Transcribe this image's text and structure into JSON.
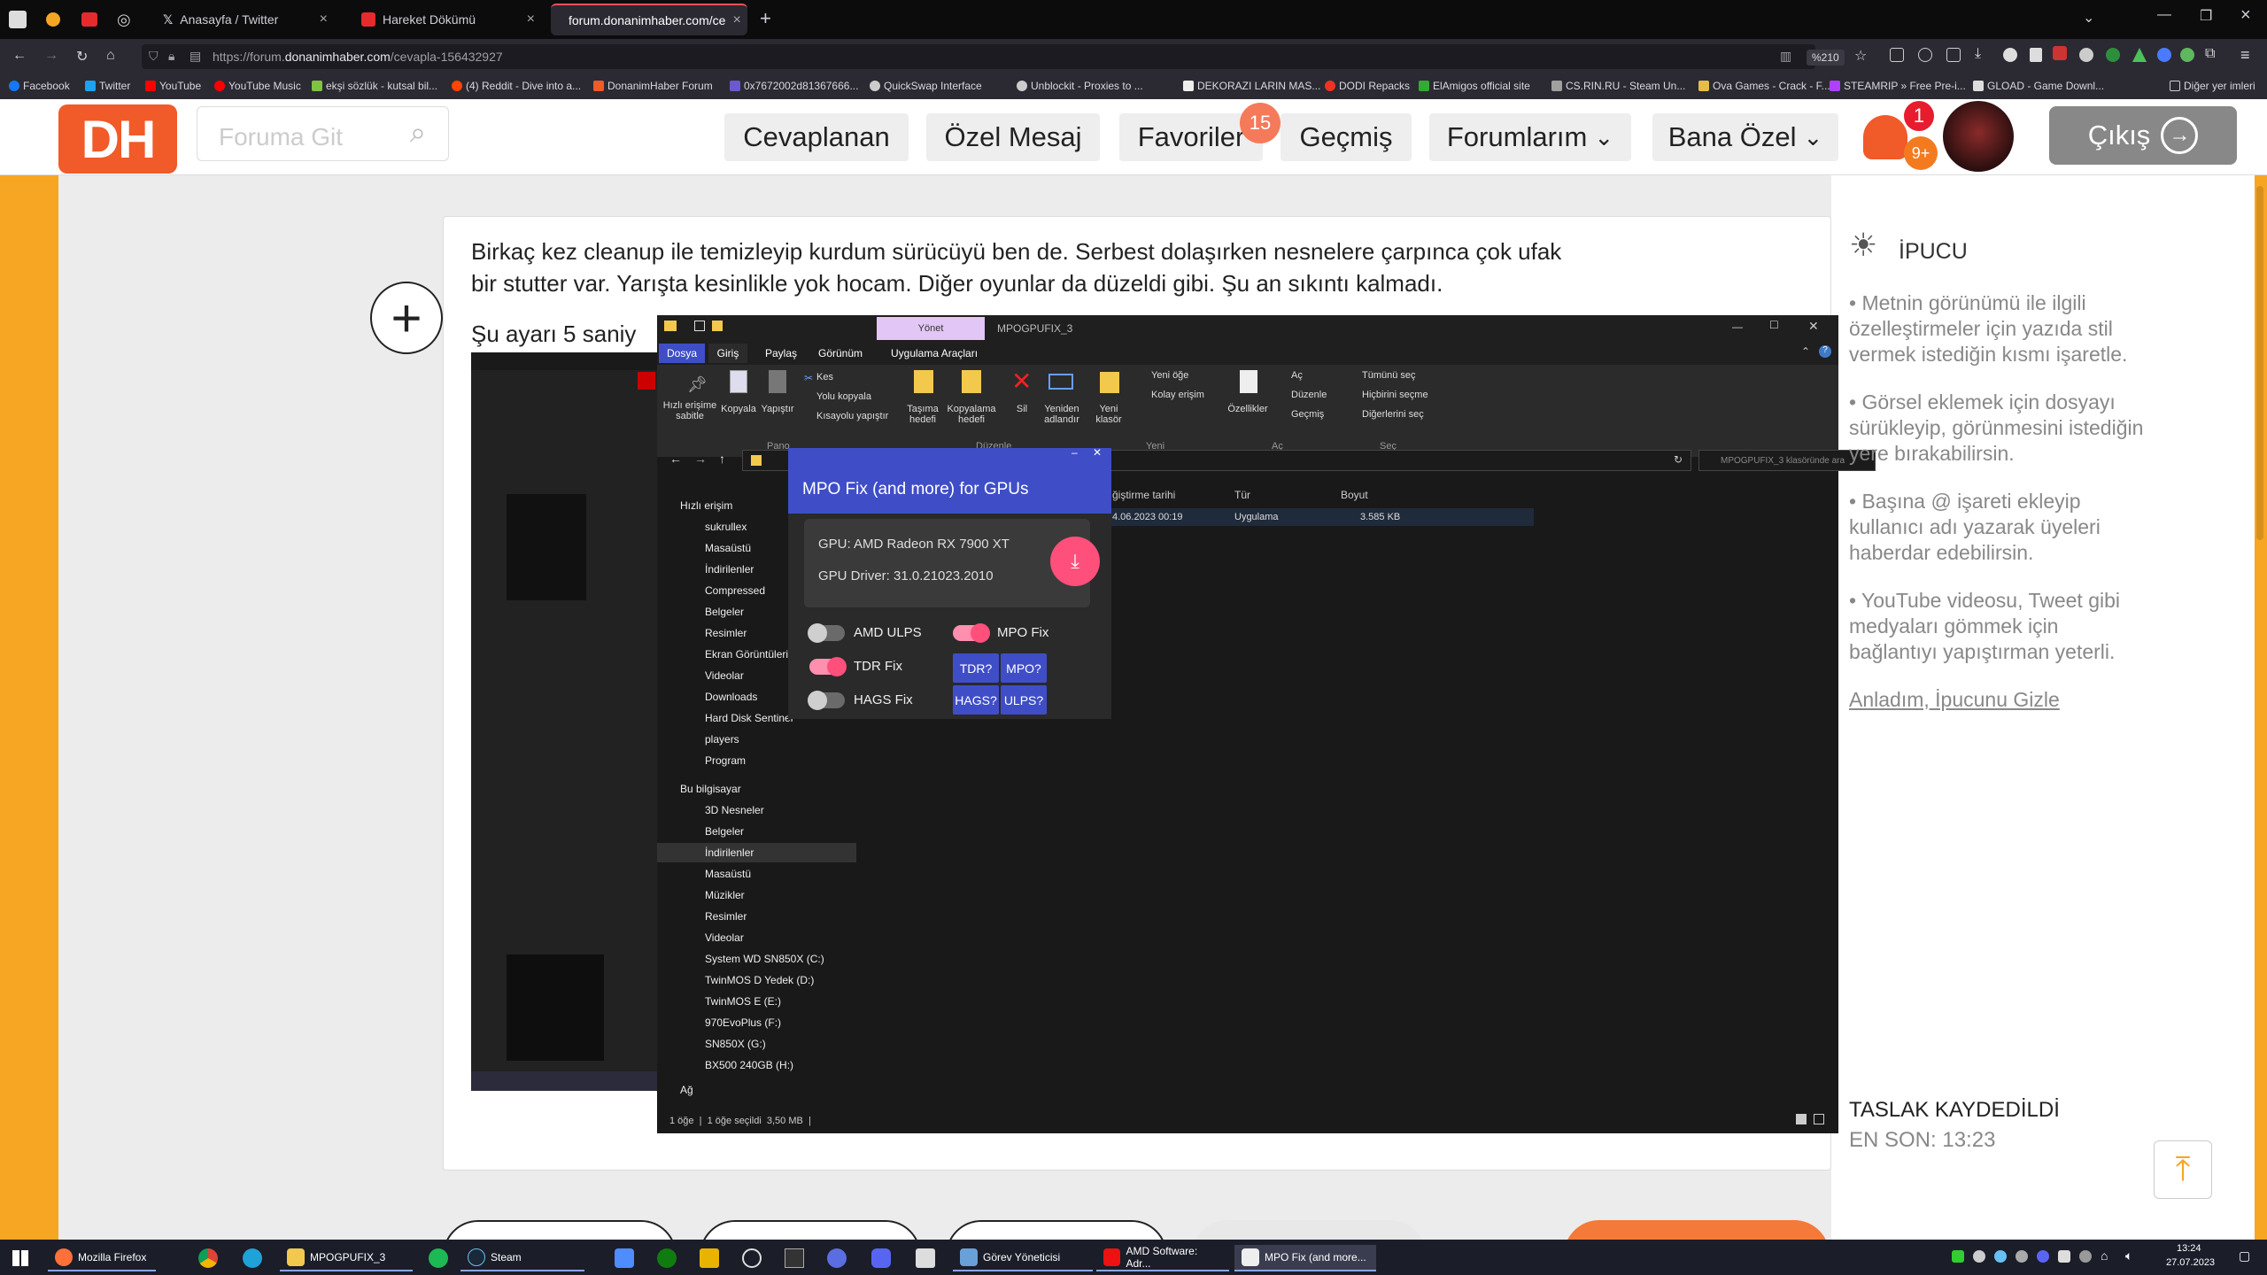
{
  "browser": {
    "tabs": [
      {
        "label": "Anasayfa / Twitter",
        "active": false
      },
      {
        "label": "Hareket Dökümü",
        "active": false
      },
      {
        "label": "forum.donanimhaber.com/ce",
        "active": true
      }
    ],
    "url_prefix": "https://forum.",
    "url_domain": "donanimhaber.com",
    "url_path": "/cevapla-156432927",
    "zoom": "%210",
    "bookmarks": [
      "Facebook",
      "Twitter",
      "YouTube",
      "YouTube Music",
      "ekşi sözlük - kutsal bil...",
      "(4) Reddit - Dive into a...",
      "DonanimHaber Forum",
      "0x7672002d81367666...",
      "QuickSwap Interface",
      "Unblockit - Proxies to ...",
      "DEKORAZI LARIN MAS...",
      "DODI Repacks",
      "ElAmigos official site",
      "CS.RIN.RU - Steam Un...",
      "Ova Games - Crack - F...",
      "STEAMRIP » Free Pre-i...",
      "GLOAD - Game Downl...",
      "Diğer yer imleri"
    ]
  },
  "site": {
    "logo": "DH",
    "search_placeholder": "Foruma Git",
    "nav": [
      "Cevaplanan",
      "Özel Mesaj",
      "Favoriler",
      "Geçmiş",
      "Forumlarım",
      "Bana Özel"
    ],
    "favorites_badge": "15",
    "notif_badge": "1",
    "msg_badge": "9+",
    "logout": "Çıkış"
  },
  "post": {
    "line1": "Birkaç kez cleanup ile temizleyip kurdum sürücüyü ben de. Serbest dolaşırken nesnelere çarpınca çok ufak",
    "line2": "bir stutter var. Yarışta kesinlikle yok hocam. Diğer oyunlar da düzeldi gibi. Şu an sıkıntı kalmadı.",
    "line3": "Şu ayarı 5 saniy"
  },
  "tips": {
    "title": "İPUCU",
    "items": [
      "• Metnin görünümü ile ilgili özelleştirmeler için yazıda stil vermek istediğin kısmı işaretle.",
      "• Görsel eklemek için dosyayı sürükleyip, görünmesini istediğin yere bırakabilirsin.",
      "• Başına @ işareti ekleyip kullanıcı adı yazarak üyeleri haberdar edebilirsin.",
      "• YouTube videosu, Tweet gibi medyaları gömmek için bağlantıyı yapıştırman yeterli."
    ],
    "hide_link": "Anladım, İpucunu Gizle",
    "draft_saved": "TASLAK KAYDEDİLDİ",
    "last_saved": "EN SON: 13:23"
  },
  "explorer": {
    "manage_tab": "Yönet",
    "title": "MPOGPUFIX_3",
    "tabs": [
      "Dosya",
      "Giriş",
      "Paylaş",
      "Görünüm",
      "Uygulama Araçları"
    ],
    "ribbon": {
      "pin": "Hızlı erişime sabitle",
      "copy": "Kopyala",
      "paste": "Yapıştır",
      "cut": "Kes",
      "copy_path": "Yolu kopyala",
      "paste_shortcut": "Kısayolu yapıştır",
      "move_to": "Taşıma hedefi",
      "copy_to": "Kopyalama hedefi",
      "delete": "Sil",
      "rename": "Yeniden adlandır",
      "new_folder": "Yeni klasör",
      "new_item": "Yeni öğe",
      "easy_access": "Kolay erişim",
      "properties": "Özellikler",
      "open": "Aç",
      "edit": "Düzenle",
      "history": "Geçmiş",
      "select_all": "Tümünü seç",
      "select_none": "Hiçbirini seçme",
      "invert": "Diğerlerini seç",
      "groups": [
        "Pano",
        "Düzenle",
        "Yeni",
        "Aç",
        "Seç"
      ]
    },
    "search_placeholder": "MPOGPUFIX_3 klasöründe ara",
    "columns": [
      "ğiştirme tarihi",
      "Tür",
      "Boyut"
    ],
    "row": {
      "date": "4.06.2023 00:19",
      "type": "Uygulama",
      "size": "3.585 KB"
    },
    "sidebar": [
      "Hızlı erişim",
      "sukrullex",
      "Masaüstü",
      "İndirilenler",
      "Compressed",
      "Belgeler",
      "Resimler",
      "Ekran Görüntüleri",
      "Videolar",
      "Downloads",
      "Hard Disk Sentinel",
      "players",
      "Program",
      "Bu bilgisayar",
      "3D Nesneler",
      "Belgeler",
      "İndirilenler",
      "Masaüstü",
      "Müzikler",
      "Resimler",
      "Videolar",
      "System WD SN850X (C:)",
      "TwinMOS D Yedek (D:)",
      "TwinMOS E (E:)",
      "970EvoPlus (F:)",
      "SN850X (G:)",
      "BX500 240GB (H:)",
      "Ağ"
    ],
    "status": "1 öğe  |  1 öğe seçildi  3,50 MB  |"
  },
  "mpo": {
    "title": "MPO Fix (and more) for GPUs",
    "gpu": "GPU: AMD Radeon RX 7900 XT",
    "driver": "GPU Driver: 31.0.21023.2010",
    "toggles": [
      {
        "label": "AMD ULPS",
        "on": false
      },
      {
        "label": "MPO Fix",
        "on": true
      },
      {
        "label": "TDR Fix",
        "on": true
      },
      {
        "label": "HAGS Fix",
        "on": false
      }
    ],
    "buttons": [
      "TDR?",
      "MPO?",
      "HAGS?",
      "ULPS?"
    ]
  },
  "taskbar": {
    "items": [
      "Mozilla Firefox",
      "MPOGPUFIX_3",
      "Steam",
      "Görev Yöneticisi",
      "AMD Software: Adr...",
      "MPO Fix (and more..."
    ],
    "time": "13:24",
    "date": "27.07.2023"
  },
  "colors": {
    "brand": "#f15a29",
    "accent": "#ff4f7b",
    "mpo_blue": "#3f4ec7"
  }
}
